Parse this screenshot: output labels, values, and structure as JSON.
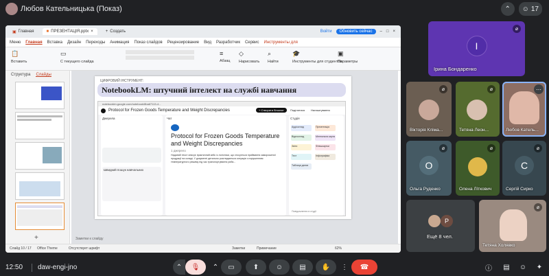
{
  "meet": {
    "presenter_title": "Любов Кательницька (Показ)",
    "participant_count": "17",
    "clock": "12:50",
    "meeting_code": "daw-engi-jno"
  },
  "app": {
    "tabs": [
      {
        "label": "Главная"
      },
      {
        "label": "ПРЕЗЕНТАЦІЯ.pptx"
      },
      {
        "label": "Создать"
      }
    ],
    "signin_label": "Войти",
    "update_label": "Обновить сейчас",
    "ribbon_tabs": [
      "Меню",
      "Главная",
      "Вставка",
      "Дизайн",
      "Переходы",
      "Анимация",
      "Показ слайдов",
      "Рецензирование",
      "Вид",
      "Разработчик",
      "Сервис",
      "Инструменты для"
    ],
    "ribbon_groups": {
      "paste": "Вставить",
      "layout": "С текущего слайда",
      "paragraph": "Абзац",
      "draw": "Нарисовать",
      "find": "Найти",
      "student_tools": "Инструменты для студентов",
      "params": "Параметры"
    },
    "left_tabs": [
      "Структура",
      "Слайды"
    ],
    "notes_placeholder": "Заметки к слайду",
    "status": {
      "slide_counter": "Слайд 10 / 17",
      "theme": "Office Theme",
      "font_missing": "Отсутствует шрифт",
      "notes": "Заметки",
      "comment": "Примечание",
      "zoom": "62%"
    }
  },
  "slide": {
    "kicker": "ЦИФРОВИЙ ІНСТРУМЕНТ:",
    "title": "NotebookLM: штучний інтелект на службі навчання",
    "nlm": {
      "url": "notebooklm.google.com/notebook/8ba67113-4...",
      "doc_title": "Protocol for Frozen Goods Temperature and Weight Discrepancies",
      "create_button": "+ Створити блокнот",
      "share_label": "Поділитися",
      "settings_label": "Налаштування",
      "sources_header": "Джерела",
      "chat_header": "Чат",
      "studio_header": "Студія",
      "source_card_label": "Швидкий пошук навчальних",
      "big_title": "Protocol for Frozen Goods Temperature and Weight Discrepancies",
      "sources_count": "1 джерело",
      "body_text": "Наданий текст описує практичний кейс із логістики, що стосується приймання замороженої продукції на складі. У документі детально розглядається ситуація з порушенням температурного режиму під час транспортування риби...",
      "studio_tiles": [
        "Аудіоогляд",
        "Презентація",
        "Відеоогляд",
        "Ментальна карта",
        "Звіти",
        "Флешкартки",
        "Тест",
        "Інфографіка",
        "Таблиця даних"
      ],
      "footer_hint": "Повідомлення в студії"
    }
  },
  "participants": [
    {
      "name": "Ірина Бондаренко",
      "letter": "І",
      "bg": "#5e35b1",
      "muted": true
    },
    {
      "name": "Вікторія Кліма...",
      "muted": true
    },
    {
      "name": "Тетяна Леон...",
      "muted": true
    },
    {
      "name": "Любов Катель...",
      "muted": false
    },
    {
      "name": "Ольга Руденко",
      "letter": "О",
      "bg": "#455a64",
      "muted": true
    },
    {
      "name": "Олена Літкович",
      "muted": true
    },
    {
      "name": "Сергій Сирко",
      "letter": "С",
      "bg": "#37474f",
      "muted": true
    },
    {
      "name": "Ещё 8 чел.",
      "letter": "P",
      "bg": "#6d4c41"
    },
    {
      "name": "Тетяна Холявко",
      "muted": true
    }
  ],
  "colors": {
    "end_call": "#ea4335",
    "accent_red": "#c43b1c",
    "mic_off_bg": "#f9dedc"
  }
}
